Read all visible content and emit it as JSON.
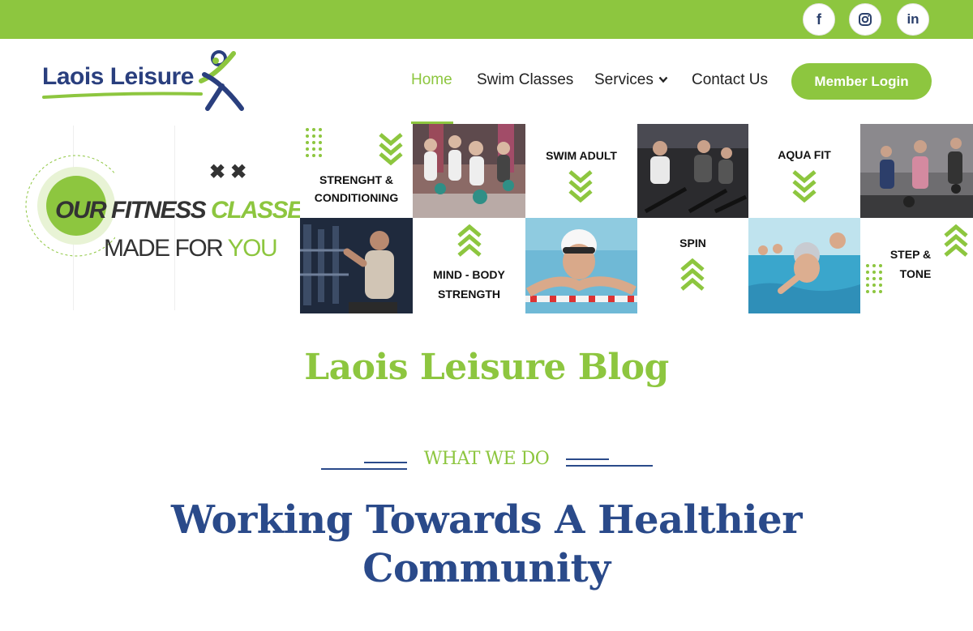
{
  "brand": {
    "name": "Laois Leisure",
    "primary_color": "#8dc63f",
    "navy_color": "#2a3f7e"
  },
  "social": [
    {
      "name": "facebook-icon",
      "glyph": "f"
    },
    {
      "name": "instagram-icon",
      "glyph": ""
    },
    {
      "name": "linkedin-icon",
      "glyph": "in"
    }
  ],
  "nav": {
    "home": "Home",
    "swim": "Swim Classes",
    "services": "Services",
    "contact": "Contact Us",
    "active": "Home"
  },
  "member_login": "Member Login",
  "banner": {
    "promo_line1_dark": "OUR FITNESS ",
    "promo_line1_green": "CLASSES",
    "promo_line2_dark": "MADE FOR ",
    "promo_line2_green": "YOU",
    "xx": "✖✖",
    "tiles": {
      "strength_line1": "STRENGHT &",
      "strength_line2": "CONDITIONING",
      "swim_adult": "SWIM ADULT",
      "aqua_fit": "AQUA FIT",
      "mind_line1": "MIND - BODY",
      "mind_line2": "STRENGTH",
      "spin": "SPIN",
      "step_line1": "STEP &",
      "step_line2": "TONE"
    }
  },
  "blog_title": "Laois Leisure Blog",
  "section": {
    "eyebrow": "WHAT WE DO",
    "headline_line1": "Working Towards A Healthier",
    "headline_line2": "Community"
  }
}
